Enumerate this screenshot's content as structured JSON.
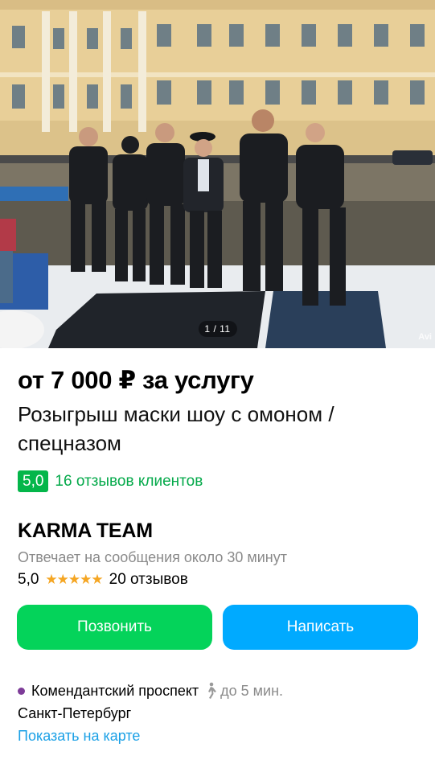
{
  "gallery": {
    "counter": "1 / 11",
    "watermark": "Avi"
  },
  "listing": {
    "price": "от 7 000 ₽ за услугу",
    "title": "Розыгрыш маски шоу с омоном / спецназом",
    "rating": "5,0",
    "reviews_link": "16 отзывов клиентов"
  },
  "seller": {
    "name": "KARMA TEAM",
    "response_time": "Отвечает на сообщения около 30 минут",
    "rating": "5,0",
    "stars": "★★★★★",
    "reviews": "20 отзывов"
  },
  "actions": {
    "call_label": "Позвонить",
    "message_label": "Написать"
  },
  "location": {
    "metro": "Комендантский проспект",
    "metro_color": "#7d3c98",
    "walk_time": "до 5 мин.",
    "city": "Санкт-Петербург",
    "map_link": "Показать на карте"
  },
  "colors": {
    "green_accent": "#04d35a",
    "blue_accent": "#00aaff",
    "rating_green": "#04b64a"
  }
}
